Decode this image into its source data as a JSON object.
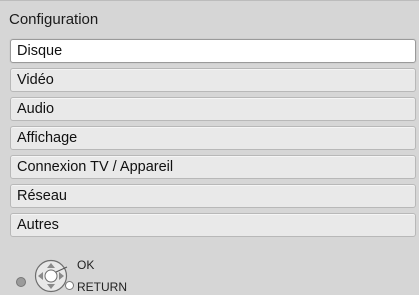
{
  "screen": {
    "title": "Configuration"
  },
  "menu": {
    "items": [
      {
        "label": "Disque",
        "selected": true
      },
      {
        "label": "Vidéo",
        "selected": false
      },
      {
        "label": "Audio",
        "selected": false
      },
      {
        "label": "Affichage",
        "selected": false
      },
      {
        "label": "Connexion TV / Appareil",
        "selected": false
      },
      {
        "label": "Réseau",
        "selected": false
      },
      {
        "label": "Autres",
        "selected": false
      }
    ]
  },
  "footer": {
    "ok_label": "OK",
    "return_label": "RETURN",
    "icons": [
      "dpad-icon",
      "return-button-icon",
      "left-dot-icon"
    ]
  },
  "colors": {
    "background": "#d6d6d6",
    "item_bg": "#e9e9e9",
    "selected_bg": "#ffffff"
  }
}
